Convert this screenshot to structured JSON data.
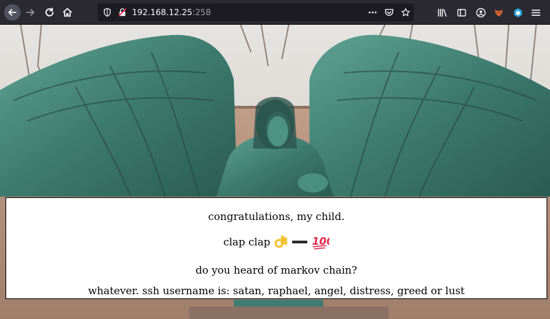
{
  "browser": {
    "url_host": "192.168.12.25",
    "url_port": ":258"
  },
  "icons": {
    "back": "arrow-left-icon",
    "forward": "arrow-right-icon",
    "reload": "reload-icon",
    "home": "home-icon",
    "shield": "shield-icon",
    "lock": "insecure-lock-icon",
    "more": "more-dots-icon",
    "pocket": "pocket-icon",
    "star": "bookmark-star-icon",
    "library": "library-icon",
    "sidebar": "sidebar-icon",
    "account": "account-icon",
    "ext1": "fox-extension-icon",
    "ext2": "cube-extension-icon",
    "menu": "hamburger-menu-icon",
    "emoji_ok": "ok-hand-emoji",
    "emoji_dash": "heavy-minus-emoji",
    "emoji_100": "hundred-points-emoji"
  },
  "colors": {
    "toolbar": "#2b2a33",
    "urlbar": "#1c1b22",
    "statue": "#3f7d72"
  },
  "message": {
    "line1": "congratulations, my child.",
    "line2": "clap clap",
    "line3": "do you heard of markov chain?",
    "line4": "whatever. ssh username is: satan, raphael, angel, distress, greed or lust"
  }
}
